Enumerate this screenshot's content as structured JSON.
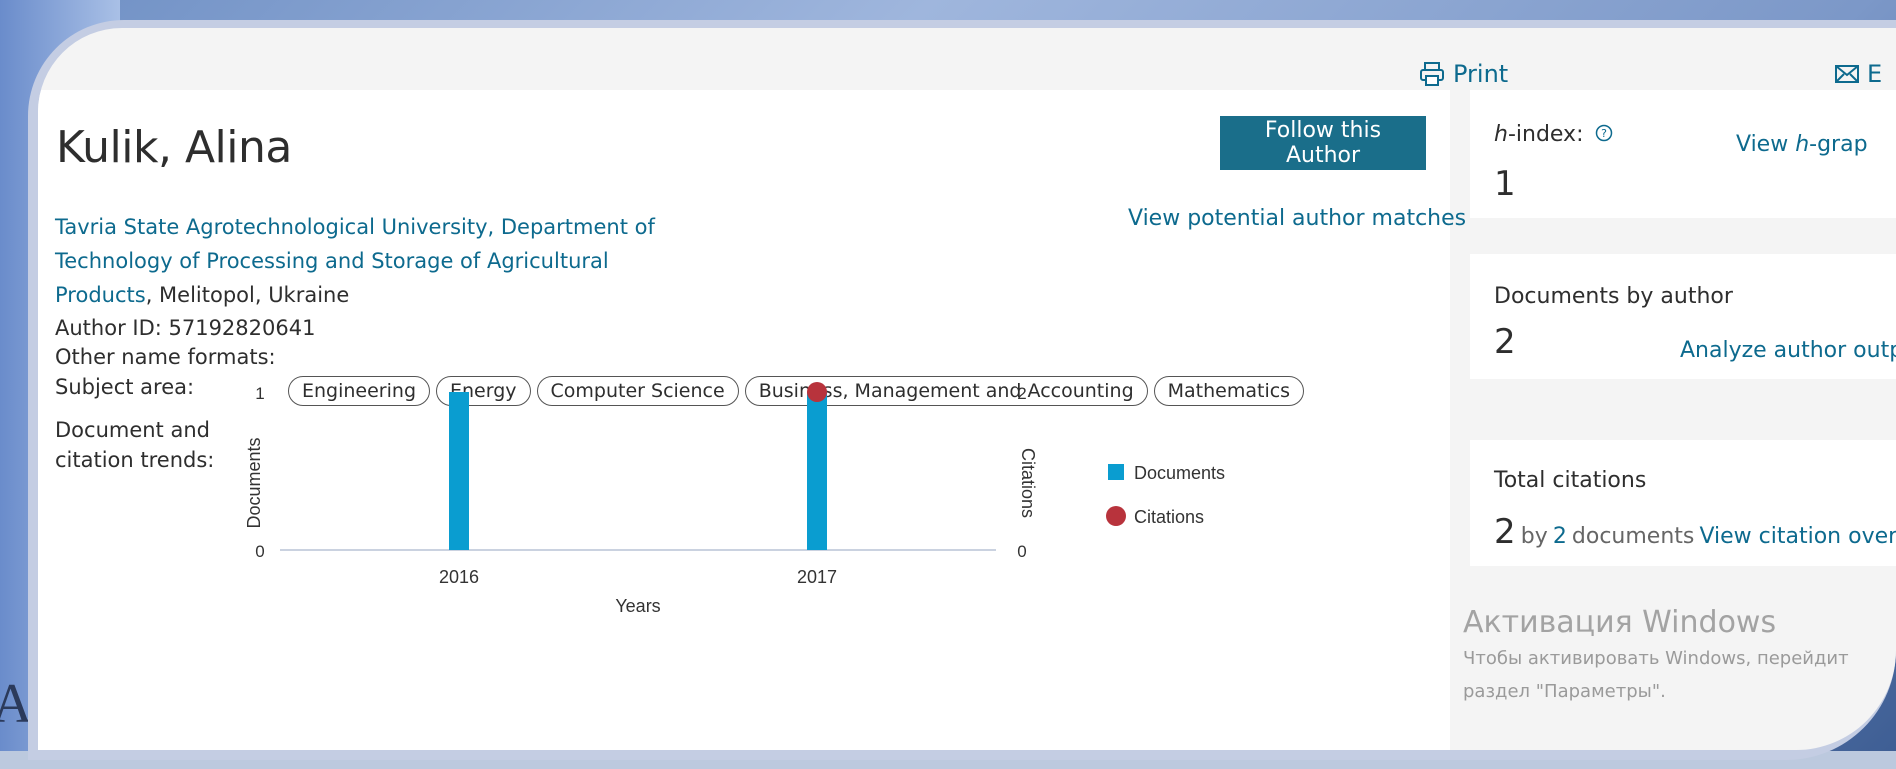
{
  "toolbar": {
    "print_label": "Print",
    "email_label": "E"
  },
  "author": {
    "name": "Kulik, Alina",
    "follow_label": "Follow this Author",
    "potential_matches_label": "View potential author matches",
    "affiliation_link": "Tavria State Agrotechnological University, Department of Technology of Processing and Storage of Agricultural Products",
    "affiliation_rest": ", Melitopol, Ukraine",
    "author_id_label": "Author ID: 57192820641",
    "other_names_label": "Other name formats:",
    "subject_area_label": "Subject area:",
    "trends_label_1": "Document and",
    "trends_label_2": "citation trends:"
  },
  "subjects": [
    "Engineering",
    "Energy",
    "Computer Science",
    "Business, Management and Accounting",
    "Mathematics"
  ],
  "chart_data": {
    "type": "bar",
    "categories": [
      "2016",
      "2017"
    ],
    "series": [
      {
        "name": "Documents",
        "values": [
          1,
          1
        ],
        "kind": "bar",
        "axis": "left",
        "color": "#0a9dd0"
      },
      {
        "name": "Citations",
        "values": [
          0,
          2
        ],
        "kind": "point",
        "axis": "right",
        "color": "#b8333c"
      }
    ],
    "xlabel": "Years",
    "ylabel_left": "Documents",
    "ylabel_right": "Citations",
    "ylim_left": [
      0,
      1
    ],
    "ylim_right": [
      0,
      2
    ],
    "left_ticks": [
      "0",
      "1"
    ],
    "right_ticks": [
      "0",
      "2"
    ],
    "legend_position": "right"
  },
  "side": {
    "hindex_label": "-index:",
    "hindex_prefix": "h",
    "hindex_value": "1",
    "hgraph_link_prefix": "View ",
    "hgraph_link_h": "h",
    "hgraph_link_suffix": "-grap",
    "documents_label": "Documents by author",
    "documents_value": "2",
    "analyze_link": "Analyze author outp",
    "citations_label": "Total citations",
    "citations_value": "2",
    "citations_by": "by",
    "citations_docs_count": "2",
    "citations_docs_word": "documents",
    "citation_overview_link": "View citation overvie"
  },
  "watermark": {
    "title": "Активация Windows",
    "line1": "Чтобы активировать Windows, перейдит",
    "line2": "раздел \"Параметры\"."
  },
  "colors": {
    "brand_teal": "#1a6e8a",
    "link": "#0d6a8e",
    "documents_bar": "#0a9dd0",
    "citations_point": "#b8333c"
  },
  "stray_letter": "A"
}
